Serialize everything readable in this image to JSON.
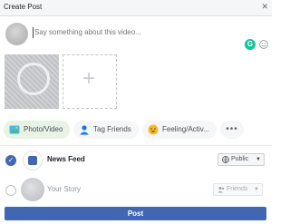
{
  "header": {
    "title": "Create Post",
    "close_icon": "✕"
  },
  "composer": {
    "placeholder": "Say something about this video..."
  },
  "media": {
    "add_icon": "+"
  },
  "attachments": {
    "photo_video": "Photo/Video",
    "tag_friends": "Tag Friends",
    "feeling_activity": "Feeling/Activ...",
    "more": "•••"
  },
  "destinations": {
    "news_feed": {
      "label": "News Feed",
      "selected": true,
      "audience": "Public",
      "check_icon": "✓"
    },
    "your_story": {
      "label": "Your Story",
      "selected": false,
      "audience": "Friends"
    }
  },
  "post_button": "Post",
  "colors": {
    "accent": "#4267b2",
    "grammarly": "#15c39a",
    "photo_pill_bg": "#e8f3e3"
  }
}
